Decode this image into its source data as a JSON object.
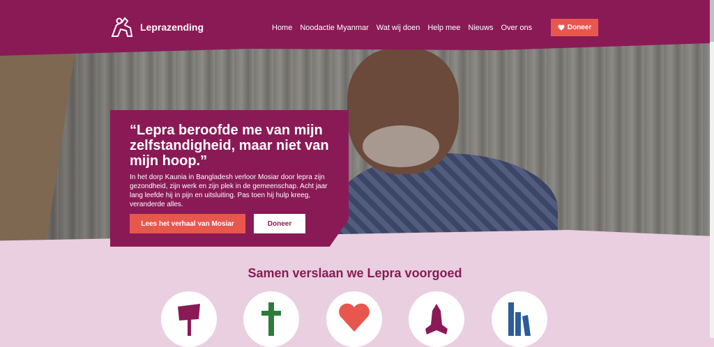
{
  "brand": {
    "name": "Leprazending"
  },
  "nav": {
    "items": [
      {
        "label": "Home"
      },
      {
        "label": "Noodactie Myanmar"
      },
      {
        "label": "Wat wij doen"
      },
      {
        "label": "Help mee"
      },
      {
        "label": "Nieuws"
      },
      {
        "label": "Over ons"
      }
    ],
    "donate_label": "Doneer"
  },
  "hero": {
    "quote": "“Lepra beroofde me van mijn zelfstandigheid, maar niet van mijn hoop.”",
    "body": "In het dorp Kaunia in Bangladesh verloor Mosiar door lepra zijn gezondheid, zijn werk en zijn plek in de gemeenschap. Acht jaar lang leefde hij in pijn en uitsluiting. Pas toen hij hulp kreeg, veranderde alles.",
    "primary_button": "Lees het verhaal van Mosiar",
    "secondary_button": "Doneer"
  },
  "section": {
    "title": "Samen verslaan we Lepra voorgoed",
    "icons": [
      {
        "name": "sign-icon",
        "color": "#8a1a56"
      },
      {
        "name": "cross-icon",
        "color": "#2f7a3a"
      },
      {
        "name": "heart-icon",
        "color": "#e8574e"
      },
      {
        "name": "praying-hands-icon",
        "color": "#8a1a56"
      },
      {
        "name": "books-icon",
        "color": "#2a5d9a"
      }
    ]
  },
  "colors": {
    "brand": "#8a1a56",
    "accent": "#e8574e",
    "background": "#e9cfe0"
  }
}
